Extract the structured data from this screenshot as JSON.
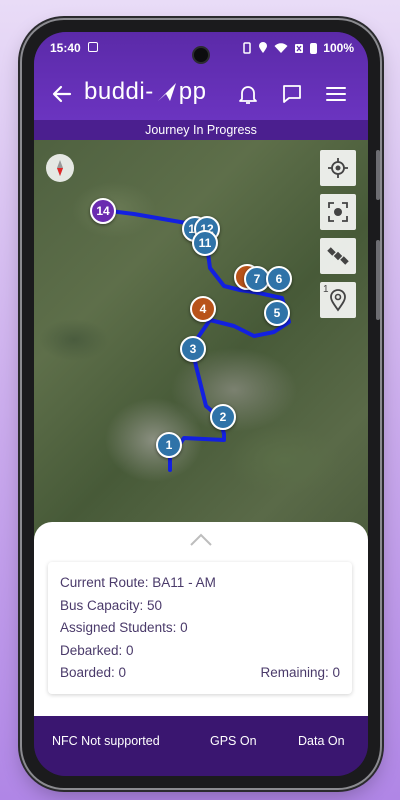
{
  "status_bar": {
    "time": "15:40",
    "battery": "100%"
  },
  "app": {
    "brand_left": "buddi-",
    "brand_right": "pp"
  },
  "banner": {
    "text": "Journey In Progress"
  },
  "map": {
    "stops": [
      {
        "label": "14",
        "color": "purple"
      },
      {
        "label": "13",
        "color": "blue"
      },
      {
        "label": "12",
        "color": "blue"
      },
      {
        "label": "11",
        "color": "blue"
      },
      {
        "label": "7",
        "color": "blue"
      },
      {
        "label": "6",
        "color": "blue"
      },
      {
        "label": "5",
        "color": "blue"
      },
      {
        "label": "4",
        "color": "orange"
      },
      {
        "label": "3",
        "color": "blue"
      },
      {
        "label": "2",
        "color": "blue"
      },
      {
        "label": "1",
        "color": "blue"
      }
    ],
    "layer_badge": "1"
  },
  "info": {
    "current_route": "Current Route: BA11 - AM",
    "bus_capacity": "Bus Capacity: 50",
    "assigned_students": "Assigned Students: 0",
    "debarked": "Debarked: 0",
    "boarded": "Boarded: 0",
    "remaining": "Remaining: 0"
  },
  "footer": {
    "nfc": "NFC Not supported",
    "gps": "GPS On",
    "data": "Data On"
  },
  "colors": {
    "header": "#6b34c0",
    "banner": "#4b1f8f",
    "footer": "#3a1670",
    "route": "#1320e0"
  }
}
